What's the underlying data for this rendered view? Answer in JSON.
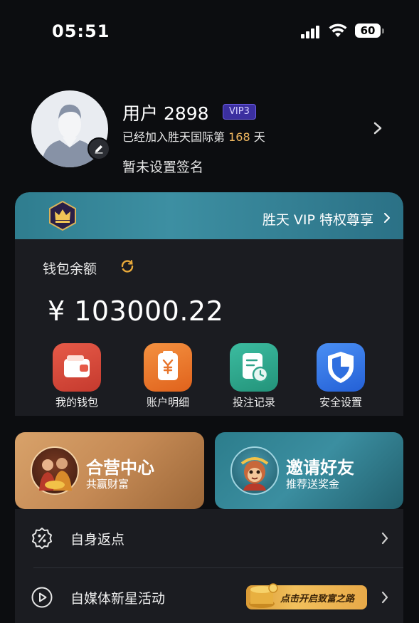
{
  "status_bar": {
    "time": "05:51",
    "battery": "60"
  },
  "profile": {
    "username": "用户 2898",
    "vip_level": "VIP3",
    "joined_prefix": "已经加入胜天国际第 ",
    "joined_days": "168",
    "joined_suffix": " 天",
    "signature": "暂未设置签名"
  },
  "vip_card": {
    "privilege_label": "胜天 VIP 特权尊享",
    "balance_label": "钱包余额",
    "balance_value": "¥ 103000.22",
    "quick_actions": [
      {
        "label": "我的钱包",
        "icon": "wallet-icon",
        "color": "#d2453a"
      },
      {
        "label": "账户明细",
        "icon": "receipt-yen-icon",
        "color": "#e8742a"
      },
      {
        "label": "投注记录",
        "icon": "record-clock-icon",
        "color": "#2fa38a"
      },
      {
        "label": "安全设置",
        "icon": "shield-icon",
        "color": "#2f6fe0"
      }
    ]
  },
  "promos": [
    {
      "title": "合营中心",
      "subtitle": "共赢财富",
      "icon": "partner-characters-icon"
    },
    {
      "title": "邀请好友",
      "subtitle": "推荐送奖金",
      "icon": "monkey-king-icon"
    }
  ],
  "menu": [
    {
      "label": "自身返点",
      "icon": "percent-badge-icon"
    },
    {
      "label": "自媒体新星活动",
      "icon": "play-circle-icon",
      "promo_text": "点击开启致富之路"
    }
  ],
  "colors": {
    "background": "#0c0d10",
    "card": "#1b1c21",
    "vip_banner": "#3d8fa2",
    "accent_days": "#f0b860"
  }
}
